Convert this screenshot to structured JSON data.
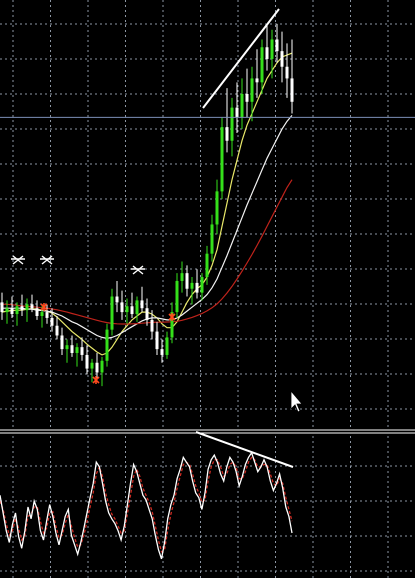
{
  "colors": {
    "background": "#000000",
    "grid": "#8d96a3",
    "candle_up": "#35e01a",
    "candle_down": "#ffffff",
    "ma_fast": "#e9e96a",
    "ma_mid": "#f3f3f3",
    "ma_slow": "#c0231b",
    "crosshair": "#7b8fb8",
    "osc_main": "#ffffff",
    "osc_signal": "#d02c23",
    "marker": "#ff4a1e",
    "trendline": "#ffffff",
    "separator": "#ffffff"
  },
  "icons": {
    "cursor": "mouse-pointer-icon",
    "fractal_up": "scissor-arrow-icon",
    "fractal_down": "asterisk-marker-icon"
  },
  "chart_data": [
    {
      "type": "candlestick",
      "title": "",
      "xlabel": "",
      "ylabel": "",
      "grid": true,
      "ylim": [
        0,
        100
      ],
      "candles": [
        [
          55,
          60,
          46,
          50
        ],
        [
          50,
          56,
          44,
          52
        ],
        [
          52,
          58,
          47,
          49
        ],
        [
          49,
          55,
          43,
          53
        ],
        [
          53,
          59,
          48,
          51
        ],
        [
          51,
          57,
          45,
          54
        ],
        [
          54,
          59,
          50,
          52
        ],
        [
          52,
          56,
          46,
          48
        ],
        [
          48,
          53,
          42,
          50
        ],
        [
          50,
          54,
          44,
          47
        ],
        [
          47,
          52,
          40,
          43
        ],
        [
          43,
          48,
          36,
          38
        ],
        [
          38,
          42,
          28,
          31
        ],
        [
          31,
          36,
          24,
          33
        ],
        [
          33,
          38,
          27,
          29
        ],
        [
          29,
          34,
          22,
          32
        ],
        [
          32,
          37,
          25,
          28
        ],
        [
          28,
          33,
          18,
          21
        ],
        [
          21,
          26,
          14,
          24
        ],
        [
          24,
          29,
          16,
          19
        ],
        [
          19,
          27,
          12,
          25
        ],
        [
          25,
          44,
          22,
          41
        ],
        [
          41,
          62,
          38,
          58
        ],
        [
          58,
          66,
          50,
          55
        ],
        [
          55,
          61,
          46,
          50
        ],
        [
          50,
          57,
          44,
          53
        ],
        [
          53,
          60,
          47,
          49
        ],
        [
          49,
          58,
          45,
          56
        ],
        [
          56,
          63,
          50,
          52
        ],
        [
          52,
          57,
          43,
          46
        ],
        [
          46,
          51,
          36,
          40
        ],
        [
          40,
          45,
          28,
          31
        ],
        [
          31,
          36,
          24,
          28
        ],
        [
          28,
          40,
          26,
          37
        ],
        [
          37,
          55,
          34,
          50
        ],
        [
          50,
          70,
          47,
          66
        ],
        [
          66,
          76,
          60,
          70
        ],
        [
          70,
          74,
          58,
          62
        ],
        [
          62,
          68,
          54,
          65
        ],
        [
          65,
          72,
          57,
          60
        ],
        [
          60,
          70,
          56,
          68
        ],
        [
          68,
          84,
          64,
          80
        ],
        [
          80,
          100,
          76,
          95
        ],
        [
          95,
          118,
          90,
          112
        ],
        [
          112,
          150,
          108,
          145
        ],
        [
          145,
          165,
          132,
          138
        ],
        [
          138,
          160,
          130,
          155
        ],
        [
          155,
          168,
          142,
          150
        ],
        [
          150,
          170,
          144,
          162
        ],
        [
          162,
          175,
          150,
          158
        ],
        [
          158,
          176,
          148,
          170
        ],
        [
          170,
          185,
          160,
          168
        ],
        [
          168,
          190,
          162,
          186
        ],
        [
          186,
          198,
          174,
          180
        ],
        [
          180,
          195,
          170,
          190
        ],
        [
          190,
          198,
          178,
          184
        ],
        [
          184,
          194,
          168,
          176
        ],
        [
          176,
          188,
          160,
          170
        ],
        [
          170,
          190,
          152,
          158
        ]
      ],
      "moving_averages": [
        {
          "values": [
            50,
            50.5,
            50.8,
            51,
            51,
            51.5,
            51.8,
            51.5,
            51,
            50.5,
            49.5,
            47.5,
            45,
            42.5,
            40,
            38,
            36,
            33.5,
            31.5,
            29.5,
            28,
            29,
            32,
            36,
            40,
            43,
            46,
            48,
            50,
            50,
            49,
            47,
            44,
            42,
            42,
            45,
            50,
            55,
            59,
            62,
            64,
            68,
            74,
            82,
            94,
            106,
            118,
            128,
            138,
            146,
            152,
            158,
            164,
            170,
            174,
            178,
            181,
            182,
            183
          ]
        },
        {
          "values": [
            52,
            52,
            52,
            52,
            52,
            51.5,
            51.5,
            51,
            50.8,
            50.5,
            50,
            49,
            48,
            46.5,
            45,
            44,
            42.5,
            41,
            39.5,
            38,
            37,
            36.5,
            37,
            38,
            39.5,
            41,
            42.5,
            44,
            45.5,
            46.5,
            47,
            47,
            46.5,
            46,
            46,
            47,
            48.5,
            50.5,
            52.5,
            54.5,
            56.5,
            59,
            62.5,
            67,
            73,
            79,
            85.5,
            92,
            98.5,
            105,
            111,
            117,
            123,
            129,
            134,
            139,
            144,
            148,
            151
          ]
        },
        {
          "values": [
            54,
            54,
            53.8,
            53.5,
            53.2,
            53,
            52.8,
            52.5,
            52.2,
            52,
            51.6,
            51.2,
            50.6,
            50,
            49.3,
            48.6,
            47.9,
            47.2,
            46.5,
            45.8,
            45.1,
            44.6,
            44.2,
            44,
            43.9,
            43.9,
            44,
            44.1,
            44.3,
            44.5,
            44.7,
            44.8,
            44.8,
            44.9,
            45,
            45.3,
            45.8,
            46.5,
            47.3,
            48.2,
            49.3,
            50.6,
            52.2,
            54.2,
            56.8,
            59.8,
            63.2,
            67,
            71,
            75.2,
            79.6,
            84.2,
            89,
            94,
            99,
            104,
            109,
            114,
            118
          ]
        }
      ],
      "crosshair_value": 150
    },
    {
      "type": "line",
      "title": "",
      "xlabel": "",
      "ylabel": "",
      "grid": true,
      "ylim": [
        0,
        100
      ],
      "series": [
        {
          "values": [
            60,
            45,
            30,
            20,
            35,
            45,
            25,
            15,
            30,
            50,
            40,
            55,
            48,
            30,
            22,
            38,
            52,
            42,
            28,
            18,
            30,
            42,
            48,
            26,
            18,
            10,
            20,
            32,
            45,
            58,
            70,
            88,
            84,
            70,
            55,
            45,
            40,
            36,
            30,
            22,
            34,
            52,
            70,
            86,
            80,
            70,
            60,
            56,
            48,
            40,
            26,
            14,
            6,
            20,
            40,
            52,
            60,
            74,
            82,
            92,
            88,
            84,
            72,
            62,
            58,
            48,
            62,
            82,
            90,
            94,
            88,
            78,
            72,
            84,
            92,
            88,
            80,
            68,
            76,
            86,
            92,
            96,
            88,
            80,
            84,
            90,
            84,
            72,
            64,
            70,
            78,
            66,
            50,
            42,
            28
          ]
        },
        {
          "values": [
            55,
            48,
            36,
            26,
            30,
            40,
            32,
            22,
            26,
            42,
            44,
            50,
            50,
            38,
            28,
            32,
            45,
            46,
            34,
            24,
            26,
            36,
            44,
            34,
            24,
            16,
            18,
            26,
            38,
            50,
            62,
            78,
            84,
            76,
            62,
            52,
            44,
            40,
            34,
            28,
            30,
            44,
            60,
            76,
            82,
            76,
            66,
            60,
            54,
            46,
            34,
            22,
            12,
            14,
            30,
            44,
            54,
            66,
            76,
            86,
            88,
            86,
            78,
            68,
            62,
            54,
            56,
            72,
            84,
            90,
            90,
            84,
            76,
            78,
            86,
            88,
            84,
            74,
            74,
            80,
            88,
            92,
            90,
            84,
            84,
            86,
            86,
            78,
            70,
            68,
            74,
            70,
            58,
            48,
            38
          ]
        }
      ]
    }
  ]
}
